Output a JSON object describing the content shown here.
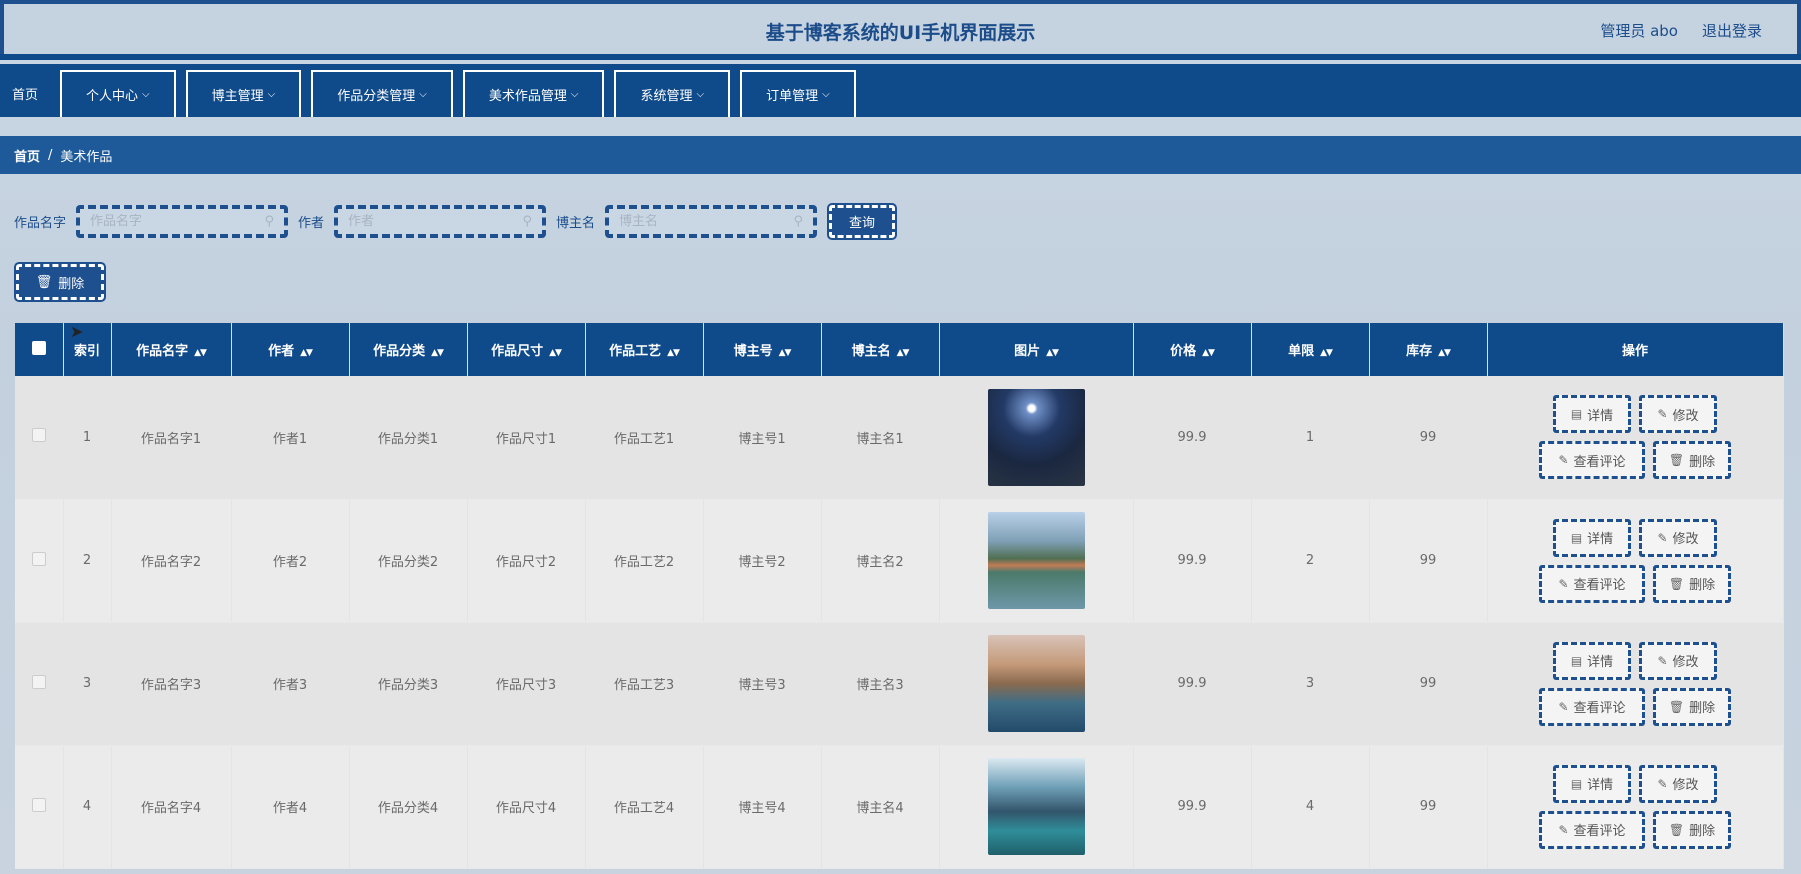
{
  "header": {
    "title": "基于博客系统的UI手机界面展示",
    "user": "管理员 abo",
    "logout": "退出登录"
  },
  "nav": [
    {
      "label": "首页",
      "dropdown": false
    },
    {
      "label": "个人中心",
      "dropdown": true
    },
    {
      "label": "博主管理",
      "dropdown": true
    },
    {
      "label": "作品分类管理",
      "dropdown": true
    },
    {
      "label": "美术作品管理",
      "dropdown": true
    },
    {
      "label": "系统管理",
      "dropdown": true
    },
    {
      "label": "订单管理",
      "dropdown": true
    }
  ],
  "breadcrumb": {
    "home": "首页",
    "separator": "/",
    "current": "美术作品"
  },
  "search": {
    "name_label": "作品名字",
    "name_placeholder": "作品名字",
    "author_label": "作者",
    "author_placeholder": "作者",
    "blogger_label": "博主名",
    "blogger_placeholder": "博主名",
    "query": "查询"
  },
  "delete_button": "删除",
  "table": {
    "columns": [
      "索引",
      "作品名字",
      "作者",
      "作品分类",
      "作品尺寸",
      "作品工艺",
      "博主号",
      "博主名",
      "图片",
      "价格",
      "单限",
      "库存",
      "操作"
    ],
    "rows": [
      {
        "index": "1",
        "name": "作品名字1",
        "author": "作者1",
        "category": "作品分类1",
        "size": "作品尺寸1",
        "craft": "作品工艺1",
        "blogger_no": "博主号1",
        "blogger_name": "博主名1",
        "price": "99.9",
        "limit": "1",
        "stock": "99",
        "image": "night-landscape"
      },
      {
        "index": "2",
        "name": "作品名字2",
        "author": "作者2",
        "category": "作品分类2",
        "size": "作品尺寸2",
        "craft": "作品工艺2",
        "blogger_no": "博主号2",
        "blogger_name": "博主名2",
        "price": "99.9",
        "limit": "2",
        "stock": "99",
        "image": "bridge-river"
      },
      {
        "index": "3",
        "name": "作品名字3",
        "author": "作者3",
        "category": "作品分类3",
        "size": "作品尺寸3",
        "craft": "作品工艺3",
        "blogger_no": "博主号3",
        "blogger_name": "博主名3",
        "price": "99.9",
        "limit": "3",
        "stock": "99",
        "image": "island-town"
      },
      {
        "index": "4",
        "name": "作品名字4",
        "author": "作者4",
        "category": "作品分类4",
        "size": "作品尺寸4",
        "craft": "作品工艺4",
        "blogger_no": "博主号4",
        "blogger_name": "博主名4",
        "price": "99.9",
        "limit": "4",
        "stock": "99",
        "image": "mountain-lake"
      }
    ],
    "actions": {
      "detail": "详情",
      "edit": "修改",
      "comments": "查看评论",
      "delete": "删除"
    }
  },
  "colors": {
    "primary": "#0f4a8a",
    "accent": "#1e5a9a",
    "background": "#c5d2e0"
  }
}
